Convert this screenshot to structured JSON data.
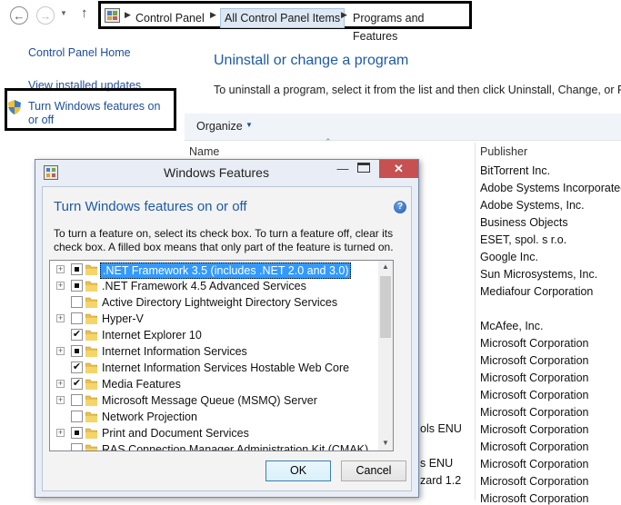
{
  "nav": {
    "back_icon": "back-arrow-icon",
    "forward_icon": "forward-arrow-icon",
    "dropdown_icon": "chevron-down-icon",
    "up_icon": "up-arrow-icon"
  },
  "address": {
    "crumbs": [
      "Control Panel",
      "All Control Panel Items",
      "Programs and Features"
    ]
  },
  "left_pane": {
    "home": "Control Panel Home",
    "updates": "View installed updates",
    "features": "Turn Windows features on or off"
  },
  "main": {
    "title": "Uninstall or change a program",
    "subtitle": "To uninstall a program, select it from the list and then click Uninstall, Change, or Repa",
    "organize": "Organize",
    "col_name": "Name",
    "col_publisher": "Publisher",
    "bg_names": [
      "ols ENU",
      "s ENU",
      "zard 1.2"
    ],
    "publishers": [
      "BitTorrent Inc.",
      "Adobe Systems Incorporated",
      "Adobe Systems, Inc.",
      "Business Objects",
      "ESET, spol. s r.o.",
      "Google Inc.",
      "Sun Microsystems, Inc.",
      "Mediafour Corporation",
      "",
      "McAfee, Inc.",
      "Microsoft Corporation",
      "Microsoft Corporation",
      "Microsoft Corporation",
      "Microsoft Corporation",
      "Microsoft Corporation",
      "Microsoft Corporation",
      "Microsoft Corporation",
      "Microsoft Corporation",
      "Microsoft Corporation",
      "Microsoft Corporation"
    ]
  },
  "dialog": {
    "window_title": "Windows Features",
    "heading": "Turn Windows features on or off",
    "description_line1": "To turn a feature on, select its check box. To turn a feature off, clear its",
    "description_line2": "check box. A filled box means that only part of the feature is turned on.",
    "ok": "OK",
    "cancel": "Cancel",
    "features": [
      {
        "label": ".NET Framework 3.5 (includes .NET 2.0 and 3.0)",
        "expandable": true,
        "state": "partial",
        "selected": true
      },
      {
        "label": ".NET Framework 4.5 Advanced Services",
        "expandable": true,
        "state": "partial",
        "selected": false
      },
      {
        "label": "Active Directory Lightweight Directory Services",
        "expandable": false,
        "state": "unchecked",
        "selected": false
      },
      {
        "label": "Hyper-V",
        "expandable": true,
        "state": "unchecked",
        "selected": false
      },
      {
        "label": "Internet Explorer 10",
        "expandable": false,
        "state": "checked",
        "selected": false
      },
      {
        "label": "Internet Information Services",
        "expandable": true,
        "state": "partial",
        "selected": false
      },
      {
        "label": "Internet Information Services Hostable Web Core",
        "expandable": false,
        "state": "checked",
        "selected": false
      },
      {
        "label": "Media Features",
        "expandable": true,
        "state": "checked",
        "selected": false
      },
      {
        "label": "Microsoft Message Queue (MSMQ) Server",
        "expandable": true,
        "state": "unchecked",
        "selected": false
      },
      {
        "label": "Network Projection",
        "expandable": false,
        "state": "unchecked",
        "selected": false
      },
      {
        "label": "Print and Document Services",
        "expandable": true,
        "state": "partial",
        "selected": false
      },
      {
        "label": "RAS Connection Manager Administration Kit (CMAK)",
        "expandable": false,
        "state": "unchecked",
        "selected": false
      }
    ]
  },
  "colors": {
    "link": "#1e4e9c",
    "title": "#1e5aa8",
    "selection": "#3399ff",
    "close_button": "#c75050"
  }
}
